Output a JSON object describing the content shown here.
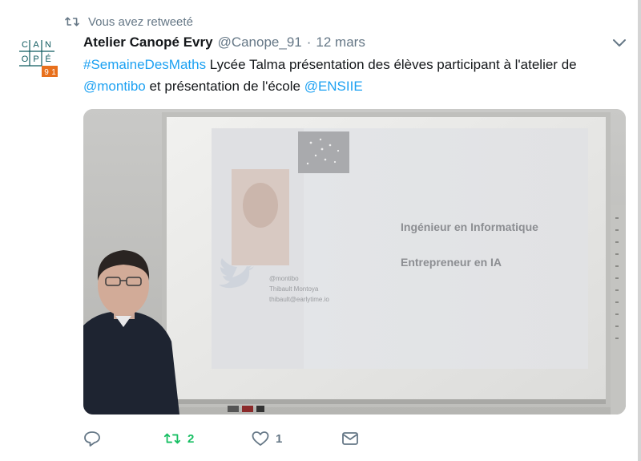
{
  "context": {
    "text": "Vous avez retweeté",
    "icon": "retweet-icon"
  },
  "author": {
    "name": "Atelier Canopé Evry",
    "handle": "@Canope_91",
    "separator": "·",
    "timestamp": "12 mars",
    "avatar_lines": [
      "C",
      "A",
      "N",
      "O",
      "P",
      "É",
      "9",
      "1"
    ]
  },
  "tweet": {
    "hashtag": "#SemaineDesMaths",
    "text_1": " Lycée Talma présentation des élèves participant à l'atelier de ",
    "mention_1": "@montibo",
    "text_2": " et présentation de l'école ",
    "mention_2": "@ENSIIE"
  },
  "slide": {
    "line_1": "Ingénieur en Informatique",
    "line_2": "Entrepreneur en IA",
    "contact_handle": "@montibo",
    "contact_name": "Thibault Montoya",
    "contact_email": "thibault@earlytime.io"
  },
  "actions": {
    "reply_icon": "reply-icon",
    "retweet_icon": "retweet-icon",
    "retweet_count": "2",
    "like_icon": "heart-icon",
    "like_count": "1",
    "dm_icon": "envelope-icon"
  },
  "colors": {
    "link": "#1da1f2",
    "retweeted": "#17bf63",
    "secondary_text": "#657786",
    "brand_teal": "#0f5a5f",
    "brand_orange": "#e8701c"
  }
}
